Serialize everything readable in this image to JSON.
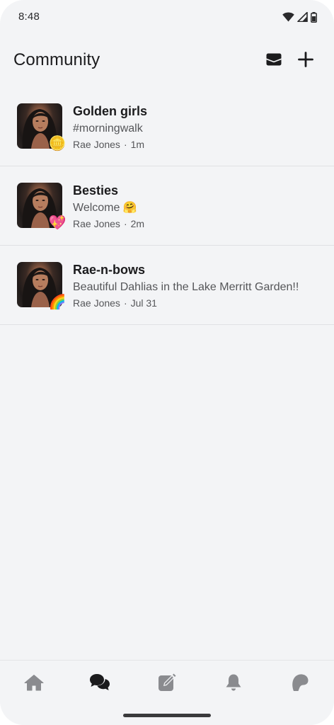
{
  "status_bar": {
    "time": "8:48",
    "icons": [
      "wifi-icon",
      "cellular-signal-icon",
      "battery-icon"
    ]
  },
  "header": {
    "title": "Community",
    "actions": [
      {
        "icon": "inbox-icon"
      },
      {
        "icon": "plus-icon"
      }
    ]
  },
  "communities": [
    {
      "title": "Golden girls",
      "subtitle": "#morningwalk",
      "author": "Rae Jones",
      "separator": "·",
      "time": "1m",
      "badge": "🪙"
    },
    {
      "title": "Besties",
      "subtitle": "Welcome 🤗",
      "author": "Rae Jones",
      "separator": "·",
      "time": "2m",
      "badge": "💖"
    },
    {
      "title": "Rae-n-bows",
      "subtitle": "Beautiful Dahlias in the Lake Merritt Garden!!",
      "author": "Rae Jones",
      "separator": "·",
      "time": "Jul 31",
      "badge": "🌈"
    }
  ],
  "bottom_nav": {
    "items": [
      {
        "icon": "home-icon",
        "active": false
      },
      {
        "icon": "chat-bubbles-icon",
        "active": true
      },
      {
        "icon": "compose-icon",
        "active": false
      },
      {
        "icon": "bell-icon",
        "active": false
      },
      {
        "icon": "groups-icon",
        "active": false
      }
    ]
  },
  "colors": {
    "background": "#f3f4f6",
    "text_primary": "#1b1b1d",
    "text_secondary": "#555659",
    "nav_inactive": "#8a8b8f",
    "nav_active": "#1b1b1d",
    "divider": "#e0e1e4"
  }
}
